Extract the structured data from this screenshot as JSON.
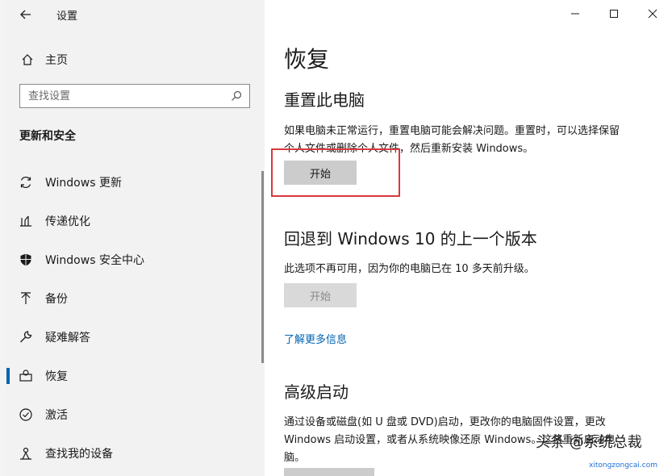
{
  "window": {
    "title": "设置",
    "controls": {
      "minimize": "—",
      "maximize": "☐",
      "close": "✕"
    }
  },
  "sidebar": {
    "home_label": "主页",
    "search_placeholder": "查找设置",
    "section_title": "更新和安全",
    "items": [
      {
        "label": "Windows 更新",
        "icon": "sync-icon"
      },
      {
        "label": "传递优化",
        "icon": "delivery-optimization-icon"
      },
      {
        "label": "Windows 安全中心",
        "icon": "shield-icon"
      },
      {
        "label": "备份",
        "icon": "backup-arrow-icon"
      },
      {
        "label": "疑难解答",
        "icon": "wrench-icon"
      },
      {
        "label": "恢复",
        "icon": "recovery-icon",
        "selected": true
      },
      {
        "label": "激活",
        "icon": "check-circle-icon"
      },
      {
        "label": "查找我的设备",
        "icon": "find-device-icon"
      }
    ]
  },
  "main": {
    "title": "恢复",
    "reset": {
      "heading": "重置此电脑",
      "line1": "如果电脑未正常运行，重置电脑可能会解决问题。重置时，可以选择保留",
      "line2": "个人文件或删除个人文件，然后重新安装 Windows。",
      "button": "开始"
    },
    "goback": {
      "heading": "回退到 Windows 10 的上一个版本",
      "description": "此选项不再可用，因为你的电脑已在 10 多天前升级。",
      "button": "开始"
    },
    "learn_more": "了解更多信息",
    "advanced": {
      "heading": "高级启动",
      "line1": "通过设备或磁盘(如 U 盘或 DVD)启动，更改你的电脑固件设置，更改",
      "line2": "Windows 启动设置，或者从系统映像还原 Windows。这将重新启动电",
      "line3": "脑。"
    }
  },
  "watermark": {
    "text": "头条 @系统总裁",
    "url": "xitongzongcai.com"
  },
  "colors": {
    "accent": "#0063b1",
    "highlight": "#d9373c",
    "sidebar_bg": "#f2f2f2"
  }
}
